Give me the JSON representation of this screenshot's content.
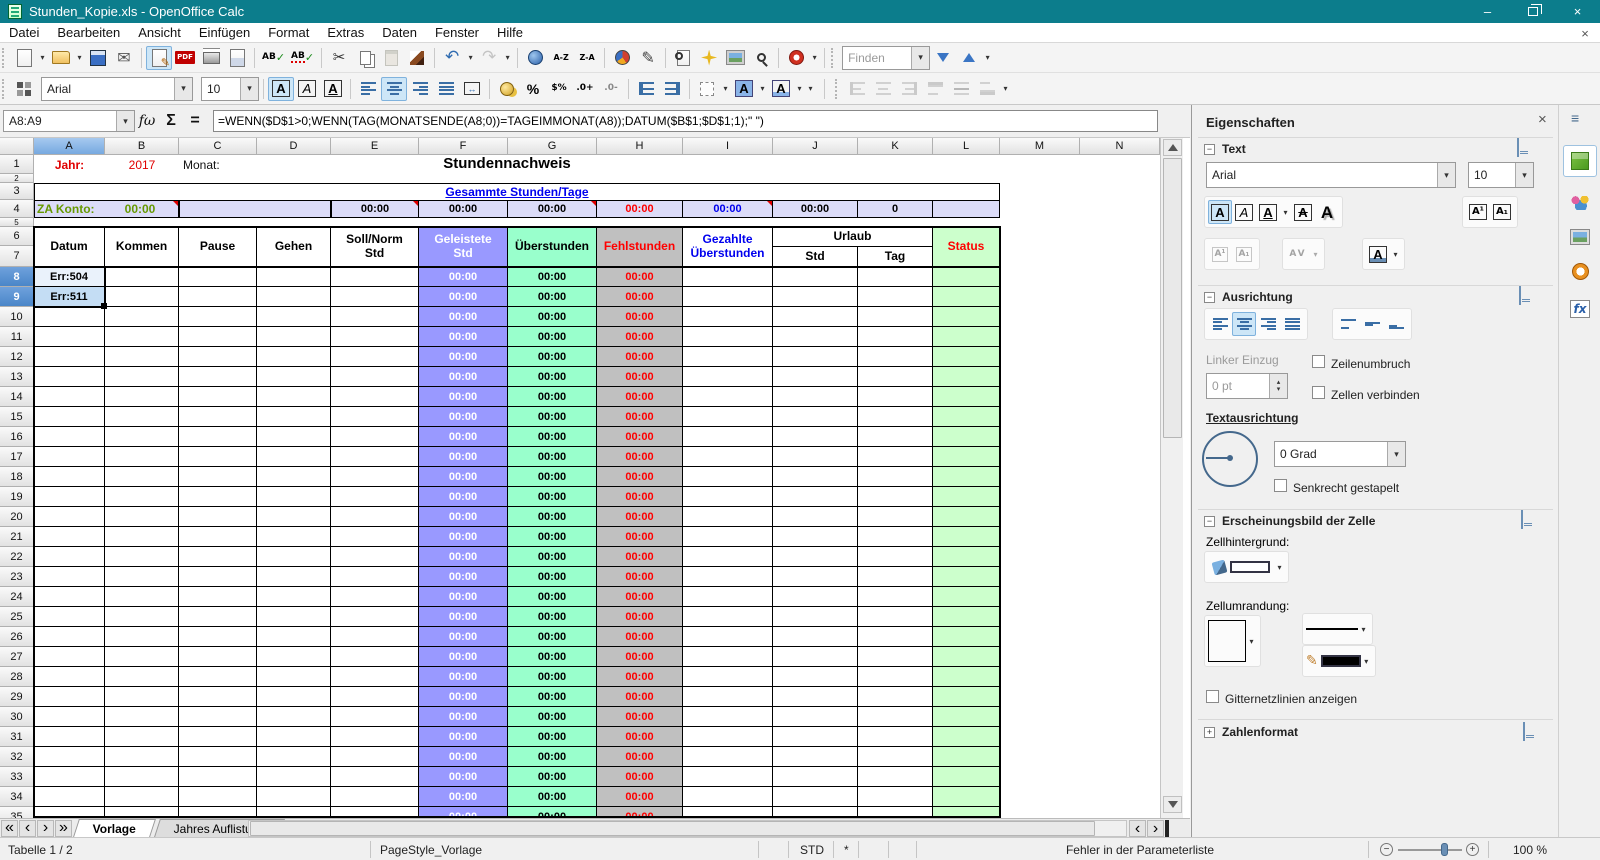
{
  "window": {
    "title": "Stunden_Kopie.xls - OpenOffice Calc"
  },
  "menubar": {
    "items": [
      "Datei",
      "Bearbeiten",
      "Ansicht",
      "Einfügen",
      "Format",
      "Extras",
      "Daten",
      "Fenster",
      "Hilfe"
    ]
  },
  "toolbar": {
    "find_placeholder": "Finden",
    "font_name": "Arial",
    "font_size": "10"
  },
  "formula_bar": {
    "cell_reference": "A8:A9",
    "fx_label": "fω",
    "sum_label": "Σ",
    "equals_label": "=",
    "formula": "=WENN($D$1>0;WENN(TAG(MONATSENDE(A8;0))=TAGEIMMONAT(A8));DATUM($B$1;$D$1;1);\" \")"
  },
  "sheet": {
    "column_letters": [
      "A",
      "B",
      "C",
      "D",
      "E",
      "F",
      "G",
      "H",
      "I",
      "J",
      "K",
      "L",
      "M",
      "N"
    ],
    "row_count": 35,
    "selected_columns": [
      "A"
    ],
    "selected_rows": [
      8,
      9
    ],
    "row1": {
      "jahr_label": "Jahr:",
      "jahr_value": "2017",
      "monat_label": "Monat:",
      "title": "Stundennachweis"
    },
    "row3": {
      "header": "Gesammte Stunden/Tage"
    },
    "row4": {
      "label": "ZA Konto:",
      "value": "00:00",
      "E": "00:00",
      "F": "00:00",
      "G": "00:00",
      "H": "00:00",
      "I": "00:00",
      "J": "00:00",
      "K": "0"
    },
    "table_headers": {
      "datum": "Datum",
      "kommen": "Kommen",
      "pause": "Pause",
      "gehen": "Gehen",
      "soll_1": "Soll/Norm",
      "soll_2": "Std",
      "geleistete_1": "Geleistete",
      "geleistete_2": "Std",
      "ueberstunden": "Überstunden",
      "fehlstunden": "Fehlstunden",
      "gezahlte_1": "Gezahlte",
      "gezahlte_2": "Überstunden",
      "urlaub": "Urlaub",
      "urlaub_std": "Std",
      "urlaub_tag": "Tag",
      "status": "Status"
    },
    "errors": {
      "a8": "Err:504",
      "a9": "Err:511"
    },
    "repeat_value": "00:00",
    "colors": {
      "geleistete_bg": "#9999ff",
      "ueberstunden_bg": "#99ffcc",
      "fehlstunden_bg": "#c0c0c0",
      "status_bg": "#ccffcc",
      "summary_row_bg": "#dcdcf8",
      "error_red": "#e00000",
      "green_text": "#669900",
      "blue_text": "#0000ee"
    }
  },
  "sheet_tabs": {
    "active": "Vorlage",
    "items": [
      "Vorlage",
      "Jahres Auflistung"
    ]
  },
  "status_bar": {
    "sheet_info": "Tabelle 1 / 2",
    "page_style": "PageStyle_Vorlage",
    "selection_mode": "STD",
    "modified_flag": "*",
    "message": "Fehler in der Parameterliste",
    "zoom_level": "100 %"
  },
  "sidebar": {
    "title": "Eigenschaften",
    "text": {
      "title": "Text",
      "font_name": "Arial",
      "font_size": "10"
    },
    "alignment": {
      "title": "Ausrichtung",
      "indent_label": "Linker Einzug",
      "indent_value": "0 pt",
      "wrap_label": "Zeilenumbruch",
      "merge_label": "Zellen verbinden",
      "orientation_label": "Textausrichtung",
      "rotation_value": "0 Grad",
      "stacked_label": "Senkrecht gestapelt"
    },
    "cell_appearance": {
      "title": "Erscheinungsbild der Zelle",
      "background_label": "Zellhintergrund:",
      "border_label": "Zellumrandung:",
      "gridlines_label": "Gitternetzlinien anzeigen"
    },
    "number_format": {
      "title": "Zahlenformat"
    }
  },
  "glyphs": {
    "dropdown": "▾",
    "spin_up": "▴",
    "spin_down": "▾",
    "scissors": "✂",
    "envelope": "✉",
    "pencil": "✎",
    "undo": "↶",
    "redo": "↷",
    "pdf": "PDF",
    "ab": "AB",
    "check": "✓",
    "a": "A",
    "percent": "%",
    "dollar_percent": "$%",
    "add_decimal": ".0+",
    "del_decimal": ".0-",
    "merge_arrows": "↔",
    "az": "A-Z",
    "za": "Z-A",
    "close": "×",
    "menu": "≡",
    "minus": "−",
    "plus": "+",
    "fx_tab": "fx",
    "nav_first": "«",
    "nav_prev": "‹",
    "nav_next": "›",
    "nav_last": "»",
    "sup": "A¹",
    "sub": "A₁",
    "spacing": "AV"
  }
}
